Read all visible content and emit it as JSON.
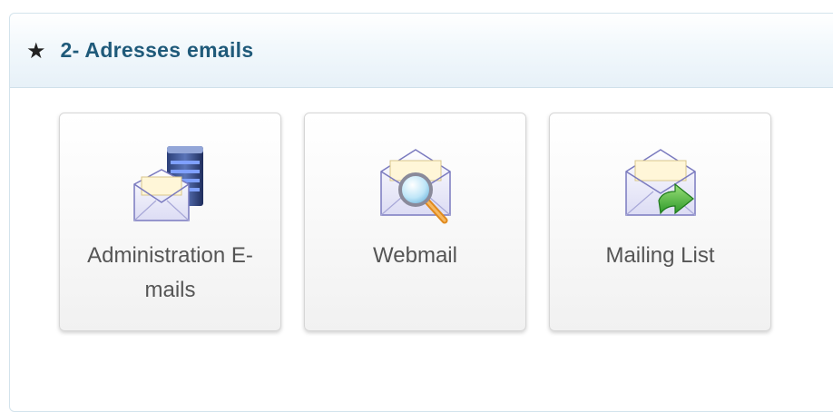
{
  "panel": {
    "title": "2- Adresses emails",
    "icon": "star-icon"
  },
  "tiles": [
    {
      "label": "Administration E-mails",
      "icon": "email-server-icon"
    },
    {
      "label": "Webmail",
      "icon": "email-search-icon"
    },
    {
      "label": "Mailing List",
      "icon": "email-forward-icon"
    }
  ],
  "colors": {
    "title": "#1f5a7a",
    "tile_text": "#555555",
    "header_bg": "#e7f1f8"
  }
}
